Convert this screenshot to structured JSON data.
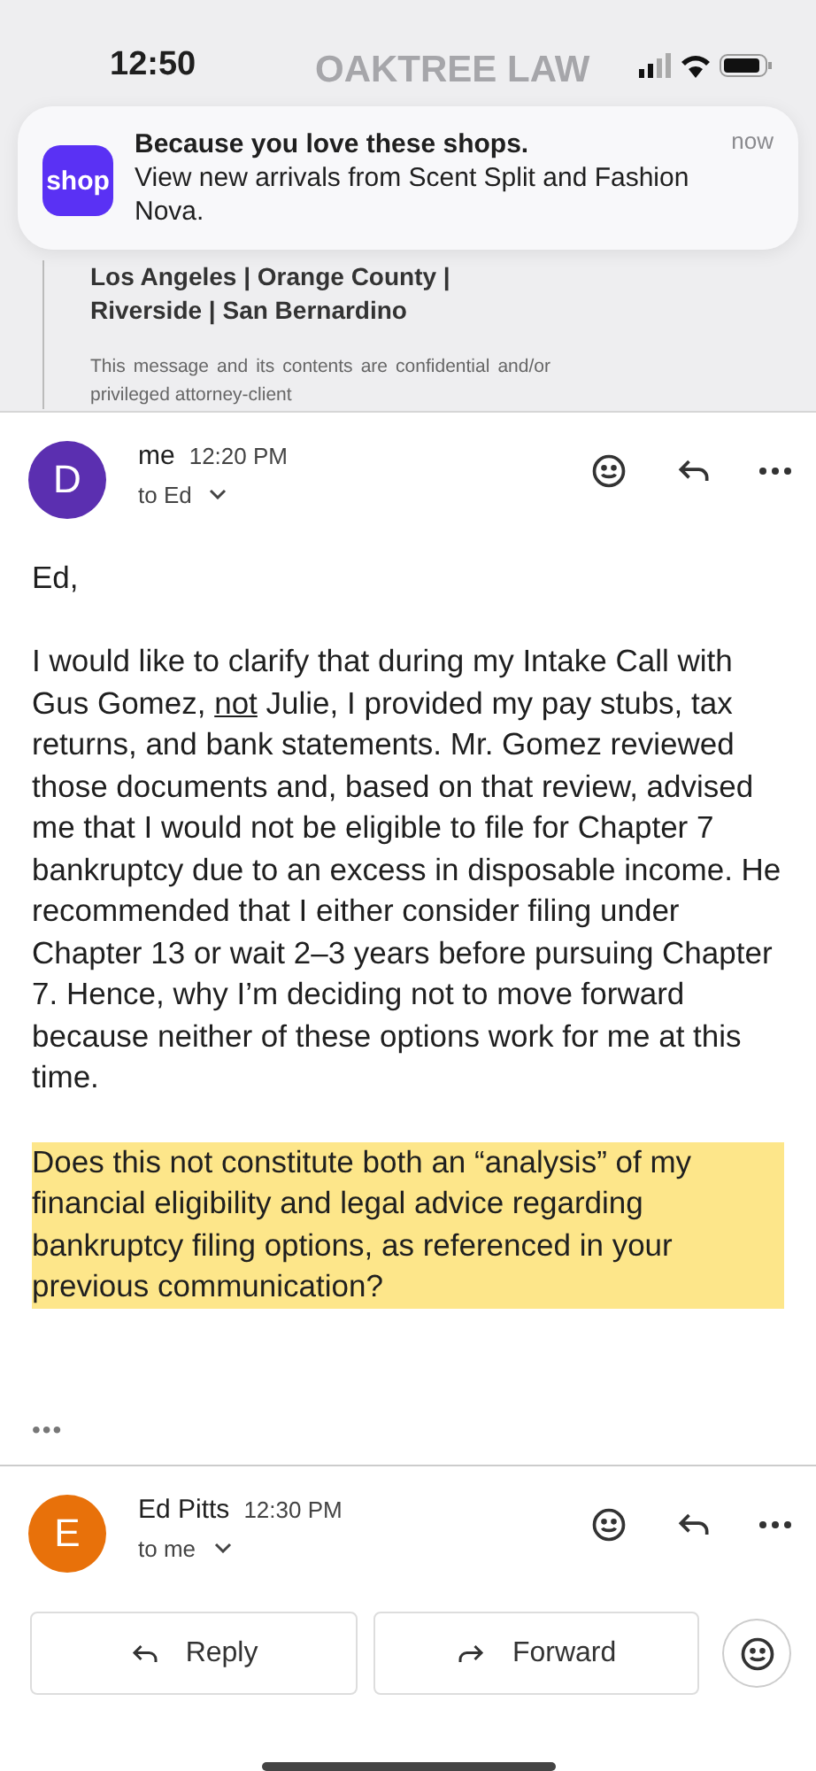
{
  "status_bar": {
    "time": "12:50"
  },
  "background_logo": "OAKTREE LAW",
  "notification": {
    "app_icon": "shop",
    "title": "Because you love these shops.",
    "body": "View new arrivals from Scent Split and Fashion Nova.",
    "time": "now"
  },
  "signature": {
    "offices": "Los Angeles | Orange County | Riverside | San Bernardino",
    "disclaimer": "This message and its contents are confidential and/or privileged attorney-client"
  },
  "messages": [
    {
      "avatar": "D",
      "color": "#5b2fb0",
      "sender": "me",
      "time": "12:20 PM",
      "recipient": "to Ed"
    },
    {
      "avatar": "E",
      "color": "#e8710a",
      "sender": "Ed Pitts",
      "time": "12:30 PM",
      "recipient": "to me"
    }
  ],
  "body": {
    "greeting": "Ed,",
    "paragraphs": [
      {
        "before": "I would like to clarify that during my Intake Call with Gus Gomez, ",
        "underlined": "not",
        "after": " Julie, I provided my pay stubs, tax returns, and bank statements. Mr. Gomez reviewed those documents and, based on that review, advised me that I would not be eligible to file for Chapter 7 bankruptcy due to an excess in disposable income. He recommended that I either consider filing under Chapter 13 or wait 2–3 years before pursuing Chapter 7. Hence, why I’m deciding not to move forward because neither of these options work for me at this time.",
        "highlighted": false
      },
      {
        "before": "Does this not constitute both an “analysis” of my financial eligibility and legal advice regarding bankruptcy filing options, as referenced in your previous communication?",
        "highlighted": true
      }
    ]
  },
  "trimmed_content": "•••",
  "actions": [
    "Reply",
    "Forward"
  ]
}
